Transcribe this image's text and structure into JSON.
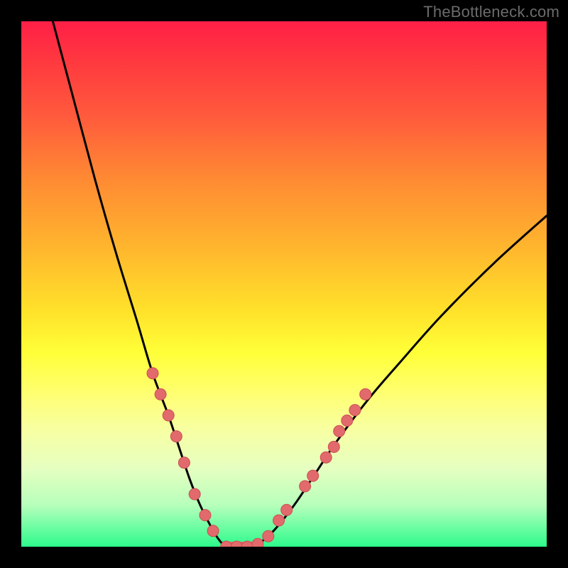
{
  "attribution": "TheBottleneck.com",
  "colors": {
    "page_bg": "#000000",
    "curve": "#000000",
    "marker_fill": "#e26a6c",
    "marker_stroke": "#c94f52",
    "gradient_top": "#ff1f47",
    "gradient_bottom": "#2dfb8c"
  },
  "chart_data": {
    "type": "line",
    "title": "",
    "xlabel": "",
    "ylabel": "",
    "xlim": [
      0,
      100
    ],
    "ylim": [
      0,
      100
    ],
    "grid": false,
    "legend": false,
    "series": [
      {
        "name": "bottleneck-curve",
        "x": [
          6,
          10,
          14,
          18,
          22,
          25,
          28,
          30,
          32,
          34,
          36,
          37.5,
          39,
          41,
          43,
          45,
          48,
          52,
          56,
          60,
          66,
          72,
          80,
          90,
          100
        ],
        "values": [
          100,
          85,
          70,
          56,
          43,
          33,
          25,
          19,
          13,
          8,
          4,
          1.5,
          0,
          0,
          0,
          0.5,
          3,
          8,
          14,
          20,
          28,
          35,
          44,
          54,
          63
        ]
      }
    ],
    "flat_bottom": {
      "x_start": 39,
      "x_end": 45,
      "value": 0
    },
    "markers": [
      {
        "x": 25.0,
        "y": 33.0
      },
      {
        "x": 26.5,
        "y": 29.0
      },
      {
        "x": 28.0,
        "y": 25.0
      },
      {
        "x": 29.5,
        "y": 21.0
      },
      {
        "x": 31.0,
        "y": 16.0
      },
      {
        "x": 33.0,
        "y": 10.0
      },
      {
        "x": 35.0,
        "y": 6.0
      },
      {
        "x": 36.5,
        "y": 3.0
      },
      {
        "x": 39.0,
        "y": 0.0
      },
      {
        "x": 41.0,
        "y": 0.0
      },
      {
        "x": 43.0,
        "y": 0.0
      },
      {
        "x": 45.0,
        "y": 0.5
      },
      {
        "x": 47.0,
        "y": 2.0
      },
      {
        "x": 49.0,
        "y": 5.0
      },
      {
        "x": 50.5,
        "y": 7.0
      },
      {
        "x": 54.0,
        "y": 11.5
      },
      {
        "x": 55.5,
        "y": 13.5
      },
      {
        "x": 58.0,
        "y": 17.0
      },
      {
        "x": 59.5,
        "y": 19.0
      },
      {
        "x": 60.5,
        "y": 22.0
      },
      {
        "x": 62.0,
        "y": 24.0
      },
      {
        "x": 63.5,
        "y": 26.0
      },
      {
        "x": 65.5,
        "y": 29.0
      }
    ]
  }
}
